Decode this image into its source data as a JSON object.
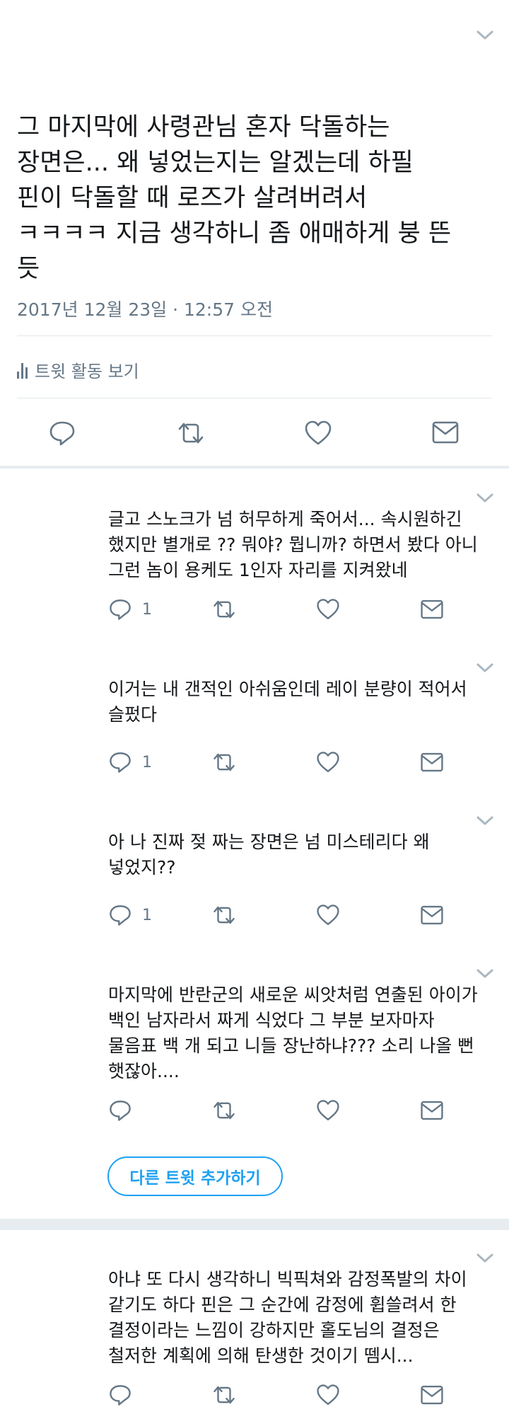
{
  "main_tweet": {
    "lines": [
      "그 마지막에 사령관님 혼자 닥돌하는",
      "장면은... 왜 넣었는지는 알겠는데 하필",
      "핀이 닥돌할 때 로즈가 살려버려서",
      "ㅋㅋㅋㅋ 지금 생각하니 좀 애매하게 붕 뜬",
      "듯"
    ],
    "timestamp": "2017년 12월 23일 · 12:57 오전",
    "activity_label": "트윗 활동 보기"
  },
  "replies": [
    {
      "lines": [
        "글고 스노크가 넘 허무하게 죽어서... 속시원하긴",
        "했지만 별개로 ?? 뭐야? 뭡니까? 하면서 봤다 아니",
        "그런 놈이 용케도 1인자 자리를 지켜왔네"
      ],
      "reply_count": "1"
    },
    {
      "lines": [
        "이거는 내 갠적인 아쉬움인데 레이 분량이 적어서",
        "슬펐다"
      ],
      "reply_count": "1"
    },
    {
      "lines": [
        "아 나 진짜 젖 짜는 장면은 넘 미스테리다 왜",
        "넣었지??"
      ],
      "reply_count": "1"
    },
    {
      "lines": [
        "마지막에 반란군의 새로운 씨앗처럼 연출된 아이가",
        "백인 남자라서 짜게 식었다 그 부분 보자마자",
        "물음표 백 개 되고 니들 장난하냐??? 소리 나올 뻔",
        "햇잖아...."
      ],
      "reply_count": ""
    },
    {
      "lines": [
        "아냐 또 다시 생각하니 빅픽쳐와 감정폭발의 차이",
        "같기도 하다 핀은 그 순간에 감정에 휩쓸려서 한",
        "결정이라는 느낌이 강하지만 홀도님의 결정은",
        "철저한 계획에 의해 탄생한 것이기 뗌시..."
      ],
      "reply_count": ""
    }
  ],
  "add_tweet_label": "다른 트윗 추가하기",
  "icons": {
    "reply": "reply-icon",
    "retweet": "retweet-icon",
    "like": "heart-icon",
    "dm": "envelope-icon",
    "more": "chevron-down-icon",
    "activity": "bar-chart-icon"
  },
  "colors": {
    "text": "#14171a",
    "secondary": "#657786",
    "accent": "#1da1f2",
    "divider": "#e1e8ed",
    "band": "#e6ecf0"
  }
}
